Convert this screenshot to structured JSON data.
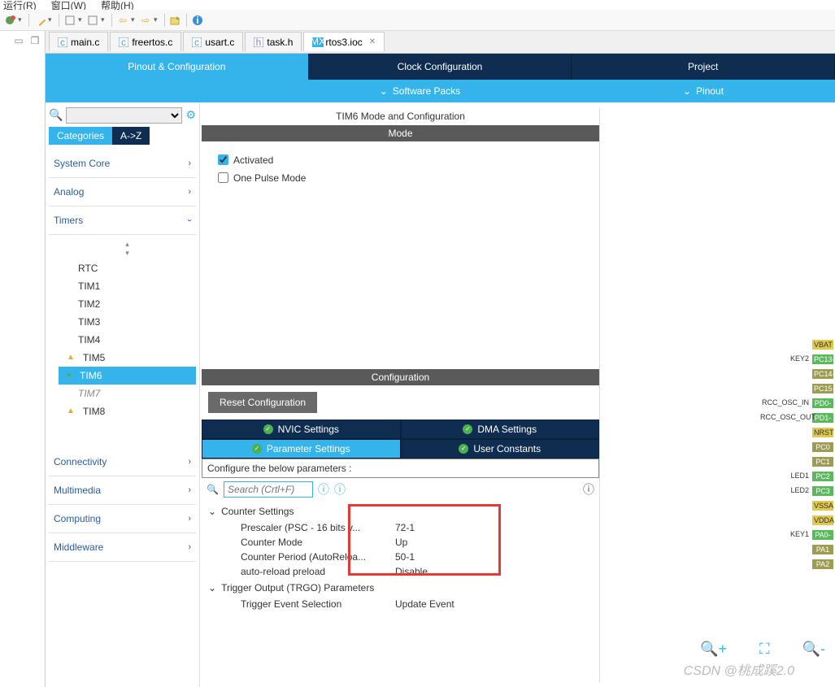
{
  "topMenu": [
    "运行(R)",
    "窗口(W)",
    "帮助(H)"
  ],
  "editorTabs": [
    {
      "label": "main.c",
      "icon": "c-file"
    },
    {
      "label": "freertos.c",
      "icon": "c-file"
    },
    {
      "label": "usart.c",
      "icon": "c-file"
    },
    {
      "label": "task.h",
      "icon": "h-file"
    },
    {
      "label": "rtos3.ioc",
      "icon": "mx-file",
      "active": true,
      "closable": true
    }
  ],
  "configTabs": {
    "pinout": "Pinout & Configuration",
    "clock": "Clock Configuration",
    "project": "Project"
  },
  "dropdownBar": {
    "software": "Software Packs",
    "pinout": "Pinout"
  },
  "sidebar": {
    "catTabs": {
      "categories": "Categories",
      "az": "A->Z"
    },
    "groups": {
      "system": "System Core",
      "analog": "Analog",
      "timers": "Timers",
      "connectivity": "Connectivity",
      "multimedia": "Multimedia",
      "computing": "Computing",
      "middleware": "Middleware"
    },
    "timerItems": [
      "RTC",
      "TIM1",
      "TIM2",
      "TIM3",
      "TIM4",
      "TIM5",
      "TIM6",
      "TIM7",
      "TIM8"
    ]
  },
  "centerPane": {
    "title": "TIM6 Mode and Configuration",
    "modeHdr": "Mode",
    "activated": "Activated",
    "onePulse": "One Pulse Mode",
    "cfgHdr": "Configuration",
    "resetBtn": "Reset Configuration",
    "subTabs": {
      "nvic": "NVIC Settings",
      "dma": "DMA Settings",
      "param": "Parameter Settings",
      "user": "User Constants"
    },
    "paramHdr": "Configure the below parameters :",
    "searchPlaceholder": "Search (Crtl+F)",
    "tree": {
      "counter": "Counter Settings",
      "prescalerK": "Prescaler (PSC - 16 bits v...",
      "prescalerV": "72-1",
      "modeK": "Counter Mode",
      "modeV": "Up",
      "periodK": "Counter Period (AutoReloa...",
      "periodV": "50-1",
      "preloadK": "auto-reload preload",
      "preloadV": "Disable",
      "trgo": "Trigger Output (TRGO) Parameters",
      "trigK": "Trigger Event Selection",
      "trigV": "Update Event"
    }
  },
  "pins": {
    "labels": [
      "KEY2",
      "RCC_OSC_IN",
      "RCC_OSC_OUT",
      "LED1",
      "LED2",
      "KEY1"
    ],
    "chips": [
      {
        "t": "VBAT",
        "c": "pin-yellow"
      },
      {
        "t": "PC13-",
        "c": "pin-green"
      },
      {
        "t": "PC14-",
        "c": "pin-khaki"
      },
      {
        "t": "PC15-",
        "c": "pin-khaki"
      },
      {
        "t": "PD0-",
        "c": "pin-green"
      },
      {
        "t": "PD1-",
        "c": "pin-green"
      },
      {
        "t": "NRST",
        "c": "pin-yellow"
      },
      {
        "t": "PC0",
        "c": "pin-khaki"
      },
      {
        "t": "PC1",
        "c": "pin-khaki"
      },
      {
        "t": "PC2",
        "c": "pin-green"
      },
      {
        "t": "PC3",
        "c": "pin-green"
      },
      {
        "t": "VSSA",
        "c": "pin-yellow"
      },
      {
        "t": "VDDA",
        "c": "pin-yellow"
      },
      {
        "t": "PA0-",
        "c": "pin-green"
      },
      {
        "t": "PA1",
        "c": "pin-khaki"
      },
      {
        "t": "PA2",
        "c": "pin-khaki"
      }
    ]
  },
  "watermark": "CSDN @桃成蹊2.0"
}
